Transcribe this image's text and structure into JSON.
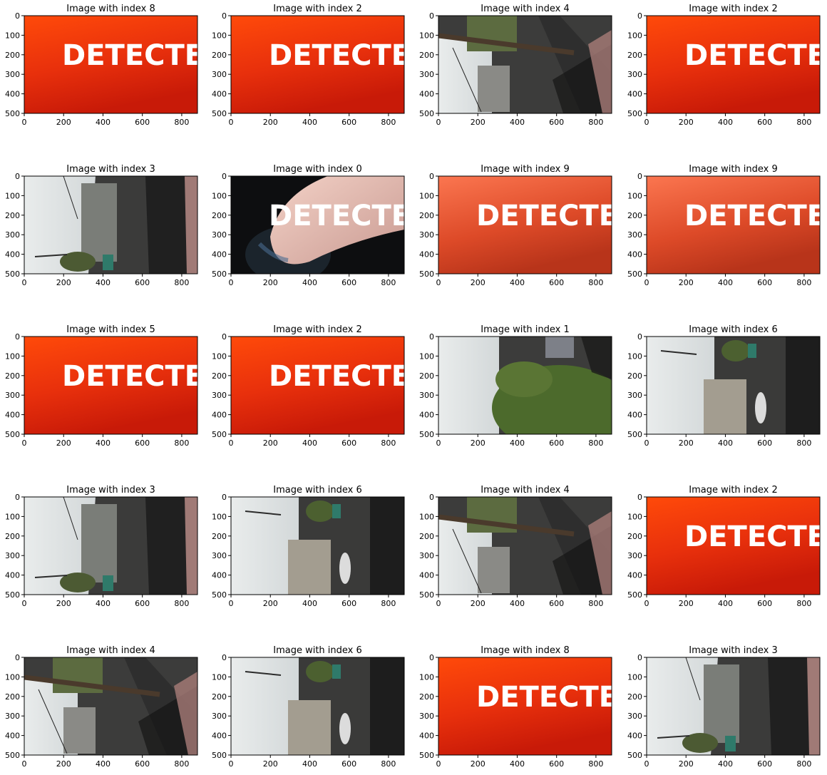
{
  "figure": {
    "rows": 5,
    "cols": 4,
    "y_ticks": [
      "0",
      "100",
      "200",
      "300",
      "400",
      "500"
    ],
    "x_ticks": [
      "0",
      "200",
      "400",
      "600",
      "800"
    ],
    "detect_text": "DETECTE",
    "panels": [
      {
        "title": "Image with index 8",
        "kind": "detect-red"
      },
      {
        "title": "Image with index 2",
        "kind": "detect-red"
      },
      {
        "title": "Image with index 4",
        "kind": "street-pole"
      },
      {
        "title": "Image with index 2",
        "kind": "detect-red"
      },
      {
        "title": "Image with index 3",
        "kind": "street-sky"
      },
      {
        "title": "Image with index 0",
        "kind": "detect-hand"
      },
      {
        "title": "Image with index 9",
        "kind": "detect-coral"
      },
      {
        "title": "Image with index 9",
        "kind": "detect-coral"
      },
      {
        "title": "Image with index 5",
        "kind": "detect-red"
      },
      {
        "title": "Image with index 2",
        "kind": "detect-red"
      },
      {
        "title": "Image with index 1",
        "kind": "street-tree"
      },
      {
        "title": "Image with index 6",
        "kind": "street-building"
      },
      {
        "title": "Image with index 3",
        "kind": "street-sky"
      },
      {
        "title": "Image with index 6",
        "kind": "street-building"
      },
      {
        "title": "Image with index 4",
        "kind": "street-pole"
      },
      {
        "title": "Image with index 2",
        "kind": "detect-red"
      },
      {
        "title": "Image with index 4",
        "kind": "street-pole"
      },
      {
        "title": "Image with index 6",
        "kind": "street-building"
      },
      {
        "title": "Image with index 8",
        "kind": "detect-red"
      },
      {
        "title": "Image with index 3",
        "kind": "street-sky"
      }
    ]
  }
}
